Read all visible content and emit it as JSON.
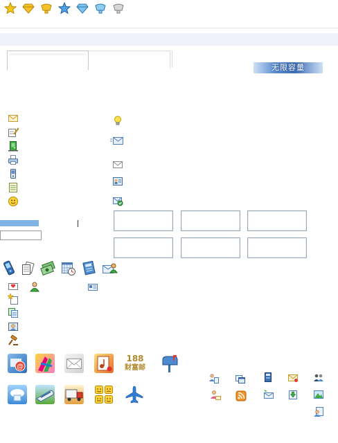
{
  "header": {
    "rank_icons": [
      "star-gold-icon",
      "diamond-gold-icon",
      "crown-gold-icon",
      "star-blue-icon",
      "diamond-blue-icon",
      "crown-blue-icon",
      "crown-silver-icon"
    ]
  },
  "tabs": [
    "",
    ""
  ],
  "storage_badge": {
    "label": "无限容量"
  },
  "left_menu": {
    "icons": [
      "envelope-icon",
      "compose-icon",
      "door-icon",
      "printer-icon",
      "mobile-icon",
      "notepad-icon",
      "smiley-icon"
    ]
  },
  "mid_menu": {
    "icons": [
      "lightbulb-icon",
      "mail-blue-icon",
      "mail-gray-icon",
      "contact-card-icon",
      "mail-check-icon"
    ]
  },
  "option_boxes": [
    "",
    "",
    "",
    "",
    "",
    ""
  ],
  "toolbar_icons": [
    "phone-icon",
    "documents-icon",
    "money-icon",
    "calendar-clock-icon",
    "address-book-icon",
    "contacts-icon"
  ],
  "small_icons": [
    "mail-heart-icon",
    "user-green-icon",
    "card-small-icon",
    "new-folder-icon",
    "copy-doc-icon",
    "contact-photo-icon",
    "gavel-icon"
  ],
  "app_tiles": {
    "row1": [
      "web-mail-tile",
      "ribbon-tile",
      "envelope-tile",
      "music-card-tile",
      "188-tile",
      "mailbox-tile"
    ],
    "row2": [
      "cloud-tile",
      "train-tile",
      "truck-tile",
      "emoticon-tile",
      "airplane-tile"
    ],
    "tile_188": {
      "number": "188",
      "caption": "财富邮"
    }
  },
  "right_icons": [
    "people-icon",
    "windows-icon",
    "book-icon",
    "mail-yellow-icon",
    "group-icon",
    "person-mail-icon",
    "rss-icon",
    "mail-send-icon",
    "download-icon",
    "landscape-icon",
    "user-settings-icon"
  ]
}
